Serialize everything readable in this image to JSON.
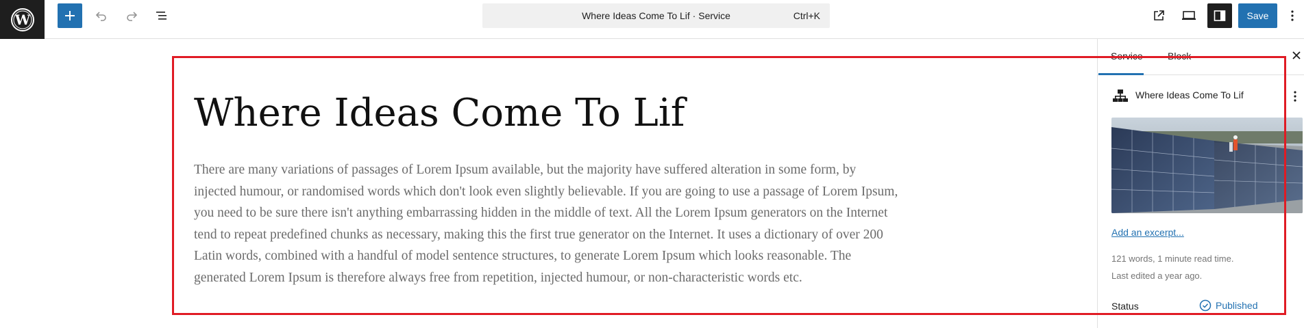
{
  "toolbar": {
    "logo_icon": "wordpress-logo-icon",
    "add_icon": "plus-icon",
    "undo_icon": "undo-icon",
    "redo_icon": "redo-icon",
    "list_view_icon": "list-view-icon",
    "command_title": "Where Ideas Come To Lif · Service",
    "command_shortcut": "Ctrl+K",
    "preview_icon": "external-link-icon",
    "device_icon": "desktop-icon",
    "settings_icon": "sidebar-toggle-icon",
    "save_label": "Save",
    "options_icon": "more-vertical-icon"
  },
  "canvas": {
    "title": "Where Ideas Come To Lif",
    "body": "There are many variations of passages of Lorem Ipsum available, but the majority have suffered alteration in some form, by injected humour, or randomised words which don't look even slightly believable. If you are going to use a passage of Lorem Ipsum, you need to be sure there isn't anything embarrassing hidden in the middle of text. All the Lorem Ipsum generators on the Internet tend to repeat predefined chunks as necessary, making this the first true generator on the Internet. It uses a dictionary of over 200 Latin words, combined with a handful of model sentence structures, to generate Lorem Ipsum which looks reasonable. The generated Lorem Ipsum is therefore always free from repetition, injected humour, or non-characteristic words etc."
  },
  "sidebar": {
    "tabs": [
      {
        "label": "Service",
        "active": true
      },
      {
        "label": "Block",
        "active": false
      }
    ],
    "close_icon": "close-icon",
    "post_card": {
      "icon": "hierarchy-icon",
      "title": "Where Ideas Come To Lif",
      "menu_icon": "more-vertical-icon"
    },
    "featured_image": "solar-panels-image",
    "excerpt_link": "Add an excerpt...",
    "meta_words": "121 words, 1 minute read time.",
    "meta_edited": "Last edited a year ago.",
    "status_label": "Status",
    "status_value": "Published",
    "status_icon": "published-check-icon"
  },
  "colors": {
    "accent": "#2271b1",
    "dark": "#1e1e1e",
    "annotation": "#e01b24",
    "body_text": "#6b6b6b"
  }
}
